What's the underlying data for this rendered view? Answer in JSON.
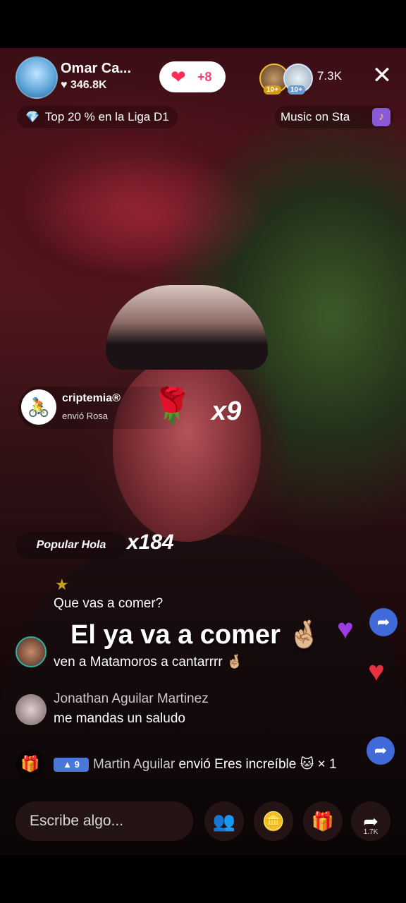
{
  "host": {
    "name": "Omar Ca...",
    "likes": "346.8K"
  },
  "follow": {
    "icon": "heart-icon",
    "count": "+8"
  },
  "viewers": {
    "badge1": "10+",
    "badge2": "10+",
    "count": "7.3K"
  },
  "close_label": "✕",
  "rank": {
    "icon": "diamond-icon",
    "text": "Top 20 % en la Liga D1"
  },
  "music": {
    "text": "Music on Sta",
    "icon": "music-stage-icon"
  },
  "gift_notice": {
    "user": "criptemia®",
    "subtitle": "envió Rosa",
    "gift_icon": "rose-icon",
    "multiplier": "x9"
  },
  "popular": {
    "label": "Popular Hola",
    "multiplier": "x184"
  },
  "chat": [
    {
      "name": "",
      "text": "Que vas a comer?"
    },
    {
      "name": "",
      "text": "ven a Matamoros a cantarrrr 🤞🏼"
    },
    {
      "name": "Jonathan Aguilar Martinez",
      "text": "me mandas un saludo"
    }
  ],
  "caption": "El ya va a comer 🤞🏼",
  "gift_row": {
    "level": "9",
    "name": "Martin Aguilar",
    "action": " envió Eres increíble 🐱 × 1"
  },
  "bottom": {
    "input_placeholder": "Escribe algo...",
    "share_count": "1.7K"
  },
  "colors": {
    "accent_red": "#ff2d55",
    "level_blue": "#4a78d8",
    "background": "#000000"
  }
}
